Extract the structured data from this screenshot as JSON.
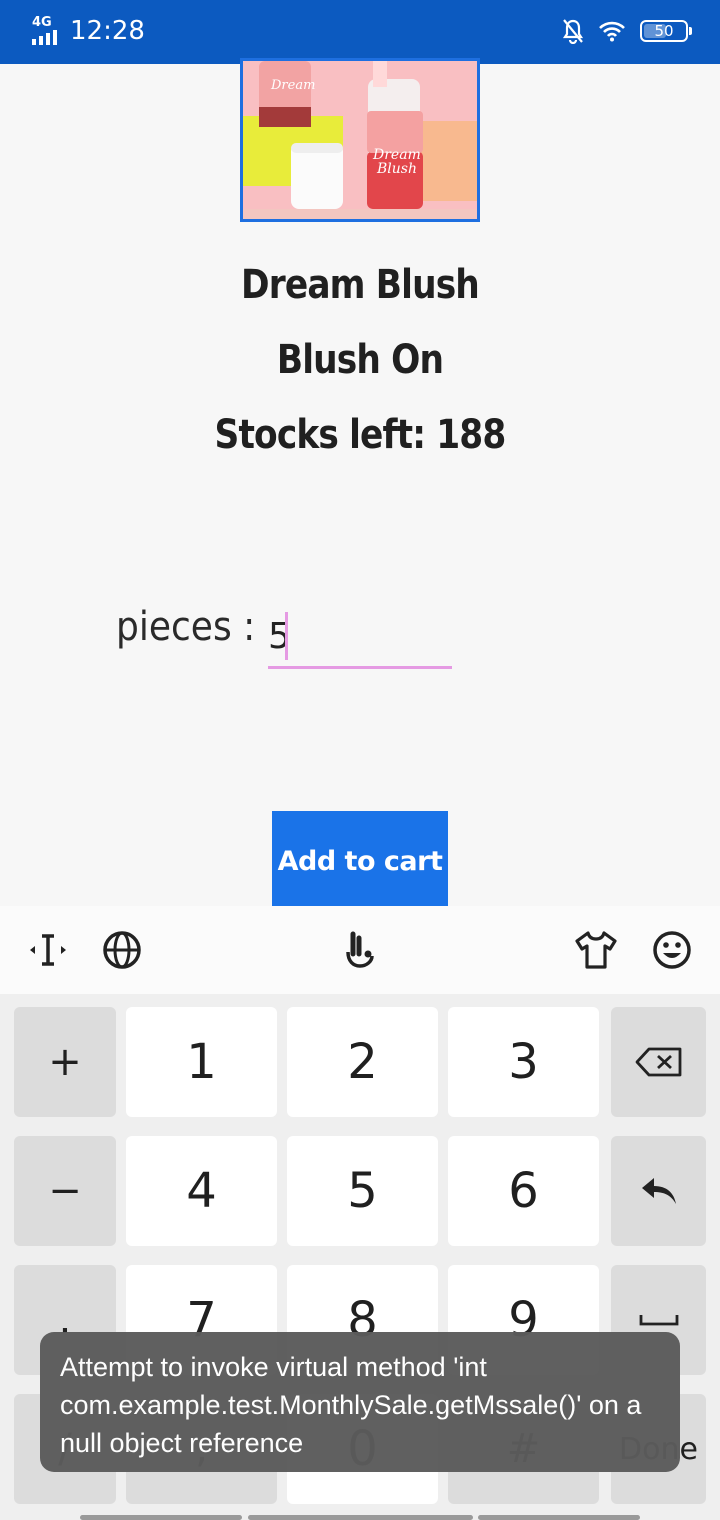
{
  "status_bar": {
    "network": "4G",
    "time": "12:28",
    "battery": "50"
  },
  "product": {
    "name": "Dream Blush",
    "category": "Blush On",
    "stock_text": "Stocks left: 188",
    "image_text": [
      "Dream",
      "Blush"
    ]
  },
  "order": {
    "pieces_label": "pieces :",
    "pieces_value": "5",
    "add_button": "Add to cart"
  },
  "keyboard": {
    "rows": [
      [
        "+",
        "1",
        "2",
        "3",
        "backspace"
      ],
      [
        "−",
        "4",
        "5",
        "6",
        "enter"
      ],
      [
        ".",
        "7",
        "8",
        "9",
        "space"
      ],
      [
        "/",
        ",",
        "0",
        "#",
        "Done"
      ]
    ],
    "done_label": "Done"
  },
  "toast": {
    "message": "Attempt to invoke virtual method 'int com.example.test.MonthlySale.getMssale()' on a null object reference"
  },
  "colors": {
    "status_bar": "#0c5ac0",
    "accent_button": "#1a73e8",
    "input_underline": "#e59ae3",
    "toast_bg": "#5b5b5b"
  }
}
